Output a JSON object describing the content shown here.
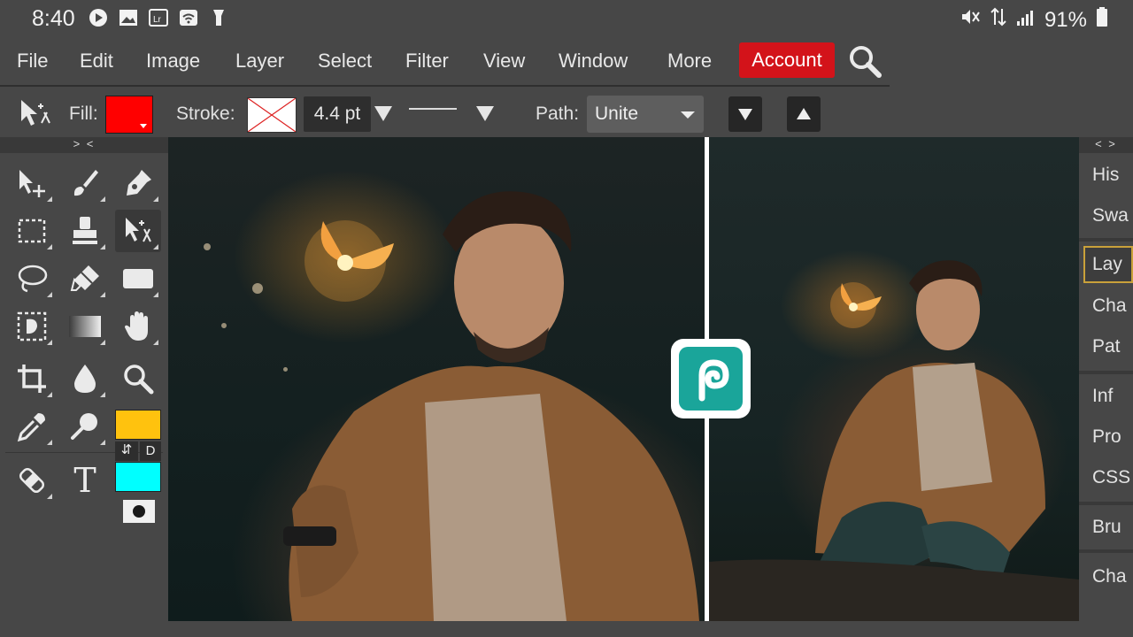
{
  "status_bar": {
    "time": "8:40",
    "battery": "91%"
  },
  "menu": {
    "items": [
      "File",
      "Edit",
      "Image",
      "Layer",
      "Select",
      "Filter",
      "View",
      "Window",
      "More"
    ],
    "account_label": "Account"
  },
  "options": {
    "fill_label": "Fill:",
    "fill_color": "#ff0000",
    "stroke_label": "Stroke:",
    "stroke_width": "4.4 pt",
    "path_label": "Path:",
    "path_mode": "Unite"
  },
  "toolbar": {
    "collapse_label": "> <",
    "foreground_color": "#ffc20e",
    "background_color": "#00ffff",
    "default_colors_label": "D",
    "swap_label": "⇵",
    "tools": [
      {
        "name": "move-tool",
        "icon": "move-icon"
      },
      {
        "name": "brush-tool",
        "icon": "brush-icon"
      },
      {
        "name": "pen-tool",
        "icon": "pen-icon"
      },
      {
        "name": "marquee-tool",
        "icon": "marquee-icon"
      },
      {
        "name": "stamp-tool",
        "icon": "stamp-icon"
      },
      {
        "name": "path-select-tool",
        "icon": "path-select-icon",
        "active": true
      },
      {
        "name": "lasso-tool",
        "icon": "lasso-icon"
      },
      {
        "name": "eraser-tool",
        "icon": "eraser-icon"
      },
      {
        "name": "shape-tool",
        "icon": "rectangle-icon"
      },
      {
        "name": "quick-select-tool",
        "icon": "quick-select-icon"
      },
      {
        "name": "gradient-tool",
        "icon": "gradient-icon"
      },
      {
        "name": "hand-tool",
        "icon": "hand-icon"
      },
      {
        "name": "crop-tool",
        "icon": "crop-icon"
      },
      {
        "name": "blur-tool",
        "icon": "drop-icon"
      },
      {
        "name": "zoom-tool",
        "icon": "zoom-icon"
      },
      {
        "name": "eyedropper-tool",
        "icon": "eyedropper-icon"
      },
      {
        "name": "dodge-tool",
        "icon": "dodge-icon"
      },
      {
        "name": "healing-tool",
        "icon": "bandage-icon"
      },
      {
        "name": "text-tool",
        "icon": "text-icon",
        "glyph": "T"
      }
    ]
  },
  "right_panel": {
    "collapse_label": "< >",
    "tabs": [
      "His",
      "Swa",
      "Lay",
      "Cha",
      "Pat",
      "Inf",
      "Pro",
      "CSS",
      "Bru",
      "Cha"
    ],
    "selected_tab": "Lay"
  },
  "colors": {
    "accent": "#d3131a",
    "ui_bg": "#474747",
    "dark_bg": "#393939",
    "logo_teal": "#1aa59a",
    "selected_tab_border": "#c9a13a"
  }
}
